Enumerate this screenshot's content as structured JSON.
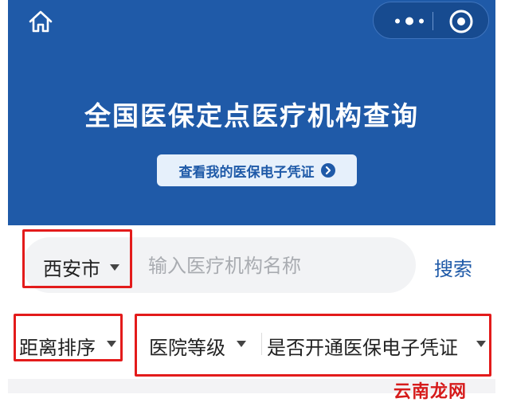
{
  "header": {
    "title": "全国医保定点医疗机构查询",
    "cert_button_label": "查看我的医保电子凭证"
  },
  "search": {
    "city": "西安市",
    "placeholder": "输入医疗机构名称",
    "button_label": "搜索"
  },
  "filters": {
    "sort": "距离排序",
    "level": "医院等级",
    "certificate": "是否开通医保电子凭证"
  },
  "watermark": "云南龙网",
  "colors": {
    "brand_blue": "#1f5aa8",
    "highlight_red": "#e31b1b"
  }
}
